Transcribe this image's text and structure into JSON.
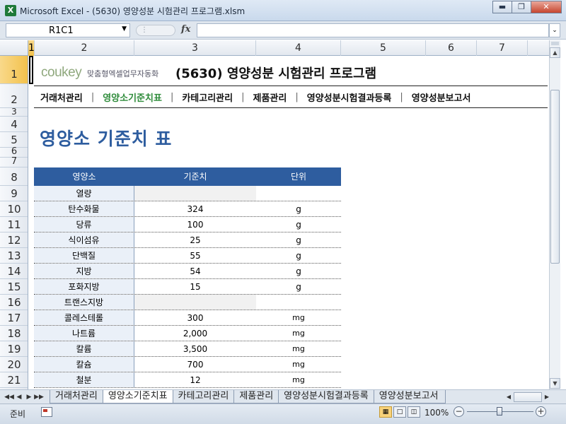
{
  "window": {
    "title": "Microsoft Excel - (5630) 영양성분 시험관리 프로그램.xlsm",
    "app_icon": "X"
  },
  "formula_bar": {
    "name_box": "R1C1",
    "fx_label": "fx",
    "formula": ""
  },
  "columns": [
    "1",
    "2",
    "3",
    "4",
    "5",
    "6",
    "7"
  ],
  "rows": [
    "1",
    "2",
    "3",
    "4",
    "5",
    "6",
    "7",
    "8",
    "9",
    "10",
    "11",
    "12",
    "13",
    "14",
    "15",
    "16",
    "17",
    "18",
    "19",
    "20",
    "21"
  ],
  "header": {
    "brand": "coukey",
    "brand_sub": "맞춤형엑셀업무자동화",
    "doc_title": "(5630) 영양성분 시험관리 프로그램"
  },
  "nav": {
    "items": [
      "거래처관리",
      "영양소기준치표",
      "카테고리관리",
      "제품관리",
      "영양성분시험결과등록",
      "영양성분보고서"
    ],
    "active_index": 1,
    "separator": "|"
  },
  "page": {
    "heading": "영양소 기준치 표"
  },
  "table": {
    "headers": [
      "영양소",
      "기준치",
      "단위"
    ],
    "rows": [
      {
        "name": "열량",
        "value": "",
        "unit": ""
      },
      {
        "name": "탄수화물",
        "value": "324",
        "unit": "g"
      },
      {
        "name": "당류",
        "value": "100",
        "unit": "g"
      },
      {
        "name": "식이섬유",
        "value": "25",
        "unit": "g"
      },
      {
        "name": "단백질",
        "value": "55",
        "unit": "g"
      },
      {
        "name": "지방",
        "value": "54",
        "unit": "g"
      },
      {
        "name": "포화지방",
        "value": "15",
        "unit": "g"
      },
      {
        "name": "트랜스지방",
        "value": "",
        "unit": ""
      },
      {
        "name": "콜레스테롤",
        "value": "300",
        "unit": "mg"
      },
      {
        "name": "나트륨",
        "value": "2,000",
        "unit": "mg"
      },
      {
        "name": "칼륨",
        "value": "3,500",
        "unit": "mg"
      },
      {
        "name": "칼슘",
        "value": "700",
        "unit": "mg"
      },
      {
        "name": "철분",
        "value": "12",
        "unit": "mg"
      }
    ]
  },
  "sheet_tabs": [
    "거래처관리",
    "영양소기준치표",
    "카테고리관리",
    "제품관리",
    "영양성분시험결과등록",
    "영양성분보고서"
  ],
  "active_sheet": 1,
  "status": {
    "ready": "준비",
    "zoom": "100%"
  },
  "colors": {
    "accent": "#2e5d9f",
    "active_nav": "#2f8c3b",
    "brand": "#8fa87d"
  }
}
